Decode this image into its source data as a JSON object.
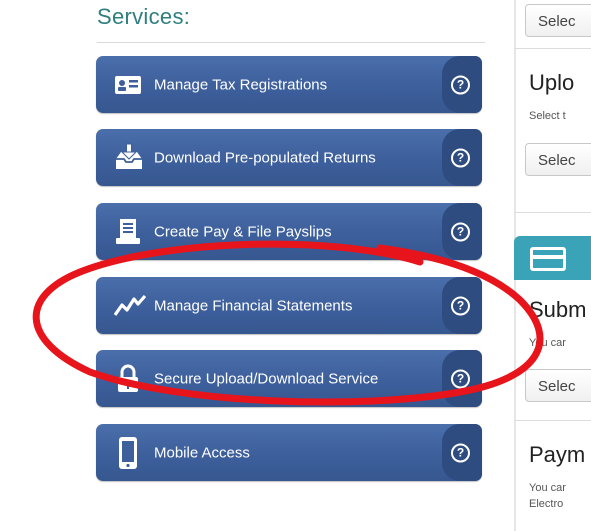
{
  "services": {
    "title": "Services:",
    "items": [
      {
        "label": "Manage Tax Registrations",
        "icon": "id-card-icon"
      },
      {
        "label": "Download Pre-populated Returns",
        "icon": "download-tray-icon"
      },
      {
        "label": "Create Pay & File Payslips",
        "icon": "payslip-icon"
      },
      {
        "label": "Manage Financial Statements",
        "icon": "chart-line-icon"
      },
      {
        "label": "Secure Upload/Download Service",
        "icon": "lock-icon"
      },
      {
        "label": "Mobile Access",
        "icon": "mobile-phone-icon"
      }
    ],
    "help_glyph": "?"
  },
  "right_panel": {
    "select_top": "Selec",
    "upload": {
      "heading": "Uplo",
      "sub": "Select t",
      "select": "Selec"
    },
    "submit": {
      "heading": "Subm",
      "sub": "You car",
      "select": "Selec"
    },
    "payment": {
      "heading": "Paym",
      "sub_line1": "You car",
      "sub_line2": "Electro"
    }
  },
  "colors": {
    "button_blue": "#3d5f9c",
    "help_zone": "#2f4c80",
    "title_teal": "#2f7f80",
    "panel_teal": "#3aa3b8",
    "annotation_red": "#e8141b"
  }
}
